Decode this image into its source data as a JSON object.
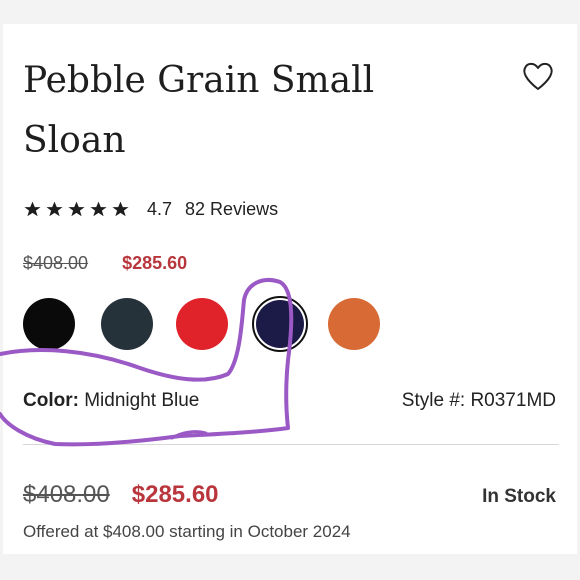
{
  "product": {
    "title": "Pebble Grain Small Sloan",
    "rating": {
      "stars": 5,
      "value": "4.7",
      "reviews_label": "82 Reviews"
    },
    "price": {
      "original": "$408.00",
      "sale": "$285.60"
    },
    "swatches": [
      {
        "name": "Black",
        "color": "#0a0a0a"
      },
      {
        "name": "Dark Slate",
        "color": "#25323a"
      },
      {
        "name": "Red",
        "color": "#e0222a"
      },
      {
        "name": "Midnight Blue",
        "color": "#1c1a46",
        "selected": true
      },
      {
        "name": "Orange",
        "color": "#d86a35"
      }
    ],
    "color_label": "Color:",
    "color_value": "Midnight Blue",
    "style_label": "Style #:",
    "style_value": "R0371MD",
    "stock_status": "In Stock",
    "offer_note": "Offered at $408.00 starting in October 2024"
  },
  "colors": {
    "sale_red": "#b8363c",
    "annotation_purple": "#9b59c6"
  },
  "icons": {
    "wishlist": "heart-outline-icon",
    "star": "star-icon"
  }
}
